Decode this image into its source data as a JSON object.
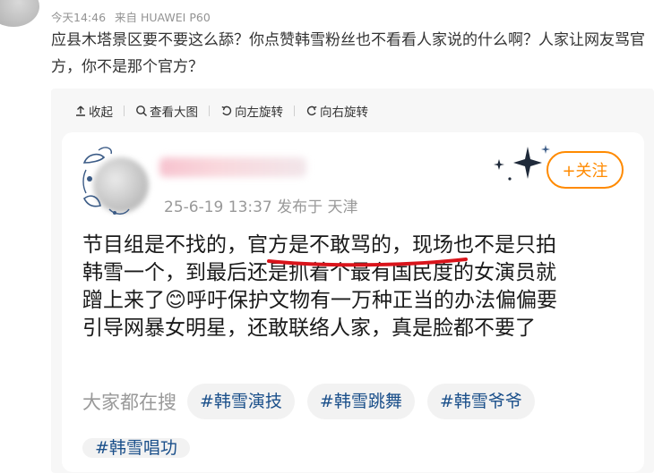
{
  "comment": {
    "time": "今天14:46",
    "device": "来自 HUAWEI P60",
    "text": "应县木塔景区要不要这么舔？你点赞韩雪粉丝也不看看人家说的什么啊？人家让网友骂官方，你不是那个官方？"
  },
  "toolbar": {
    "collapse": "收起",
    "view_large": "查看大图",
    "rotate_left": "向左旋转",
    "rotate_right": "向右旋转"
  },
  "post": {
    "meta": "25-6-19 13:37  发布于 天津",
    "follow_label": "+关注",
    "lines": [
      "节目组是不找的，官方是不敢骂的，现场也不是只拍",
      "韩雪一个，到最后还是抓着个最有国民度的女演员就",
      "蹭上来了😊呼吁保护文物有一万种正当的办法偏偏要",
      "引导网暴女明星，还敢联络人家，真是脸都不要了"
    ],
    "search_label": "大家都在搜",
    "tags": [
      "#韩雪演技",
      "#韩雪跳舞",
      "#韩雪爷爷",
      "#韩雪唱功"
    ]
  },
  "colors": {
    "accent": "#ff8a00",
    "tag_text": "#1a4f8a",
    "underline": "#d9141b"
  }
}
